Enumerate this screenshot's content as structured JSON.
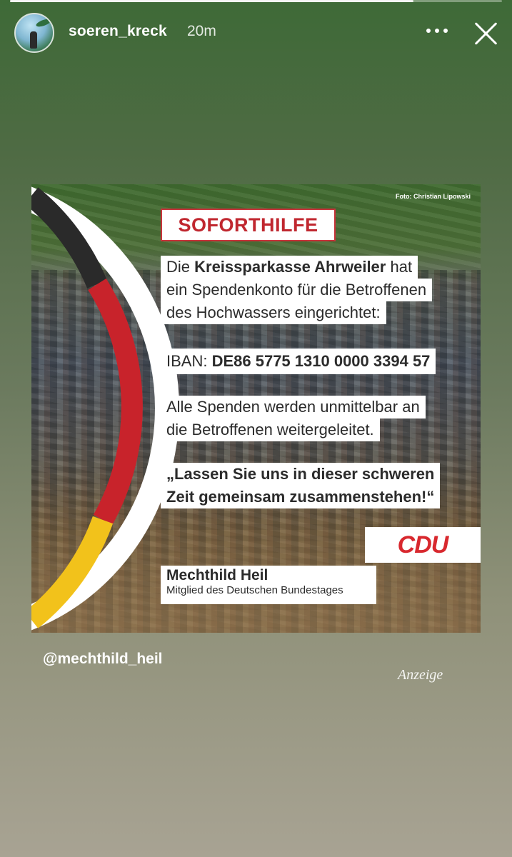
{
  "story": {
    "progress": 0.82,
    "username": "soeren_kreck",
    "time": "20m"
  },
  "post": {
    "photo_credit": "Foto: Christian Lipowski",
    "headline": "SOFORTHILFE",
    "line1_pre": "Die ",
    "line1_bold": "Kreissparkasse Ahrweiler",
    "line1_post": " hat",
    "line2": "ein Spendenkonto für die Betroffenen",
    "line3": "des Hochwassers eingerichtet:",
    "iban_label": "IBAN: ",
    "iban_value": "DE86 5775 1310 0000 3394 57",
    "line4": "Alle Spenden werden unmittelbar an",
    "line5": "die Betroffenen weitergeleitet.",
    "quote1": "„Lassen Sie uns in dieser schweren",
    "quote2": "Zeit gemeinsam zusammenstehen!“",
    "party": "CDU",
    "person_name": "Mechthild Heil",
    "person_role": "Mitglied des Deutschen Bundestages"
  },
  "mention": "@mechthild_heil",
  "ad_label": "Anzeige",
  "colors": {
    "cdu_red": "#d8282e",
    "flag_black": "#2a2a2a",
    "flag_red": "#c8232b",
    "flag_gold": "#f2c21b"
  }
}
